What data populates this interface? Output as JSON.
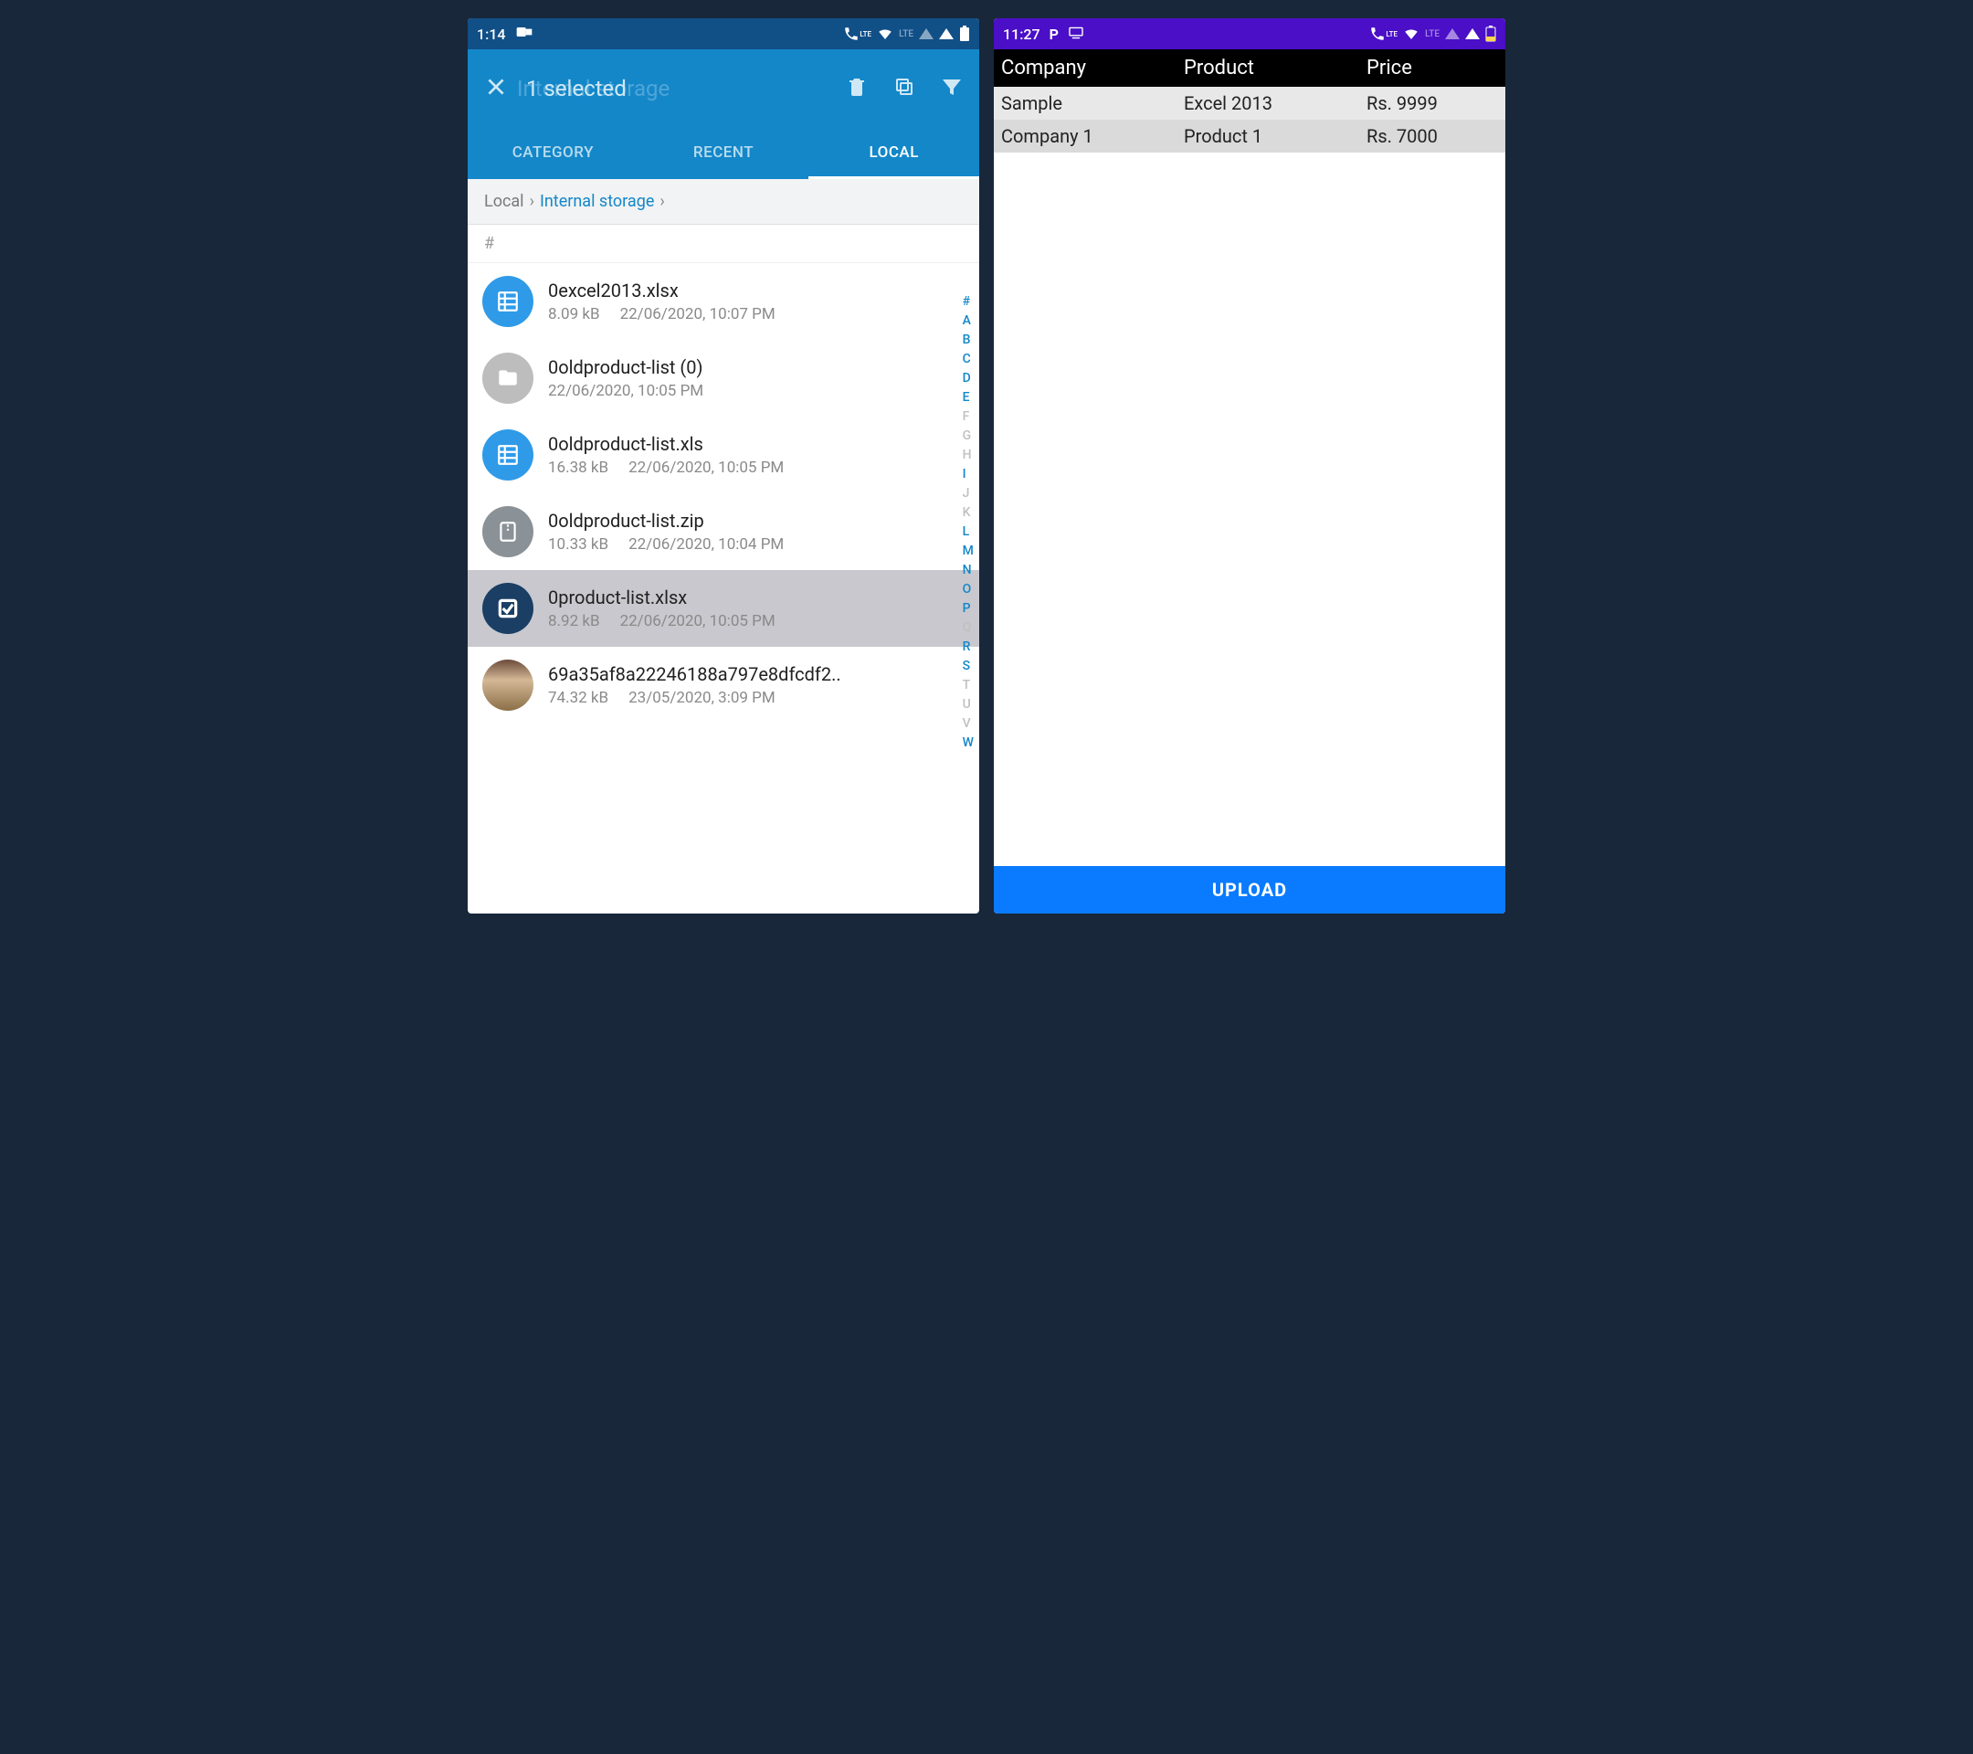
{
  "left": {
    "status": {
      "time": "1:14"
    },
    "appbar": {
      "title": "1 selected",
      "ghost": "Internal storage"
    },
    "tabs": [
      {
        "label": "CATEGORY",
        "active": false
      },
      {
        "label": "RECENT",
        "active": false
      },
      {
        "label": "LOCAL",
        "active": true
      }
    ],
    "breadcrumb": {
      "root": "Local",
      "current": "Internal storage"
    },
    "section": "#",
    "files": [
      {
        "name": "0excel2013.xlsx",
        "size": "8.09 kB",
        "date": "22/06/2020, 10:07 PM",
        "type": "xls",
        "selected": false
      },
      {
        "name": "0oldproduct-list (0)",
        "size": "",
        "date": "22/06/2020, 10:05 PM",
        "type": "folder",
        "selected": false
      },
      {
        "name": "0oldproduct-list.xls",
        "size": "16.38 kB",
        "date": "22/06/2020, 10:05 PM",
        "type": "xls",
        "selected": false
      },
      {
        "name": "0oldproduct-list.zip",
        "size": "10.33 kB",
        "date": "22/06/2020, 10:04 PM",
        "type": "zip",
        "selected": false
      },
      {
        "name": "0product-list.xlsx",
        "size": "8.92 kB",
        "date": "22/06/2020, 10:05 PM",
        "type": "xls",
        "selected": true
      },
      {
        "name": "69a35af8a22246188a797e8dfcdf2..",
        "size": "74.32 kB",
        "date": "23/05/2020, 3:09 PM",
        "type": "img",
        "selected": false
      }
    ],
    "index": {
      "letters": [
        "#",
        "A",
        "B",
        "C",
        "D",
        "E",
        "F",
        "G",
        "H",
        "I",
        "J",
        "K",
        "L",
        "M",
        "N",
        "O",
        "P",
        "Q",
        "R",
        "S",
        "T",
        "U",
        "V",
        "W"
      ],
      "active": [
        "#",
        "A",
        "B",
        "C",
        "D",
        "E",
        "I",
        "L",
        "M",
        "N",
        "O",
        "P",
        "R",
        "S",
        "W"
      ]
    }
  },
  "right": {
    "status": {
      "time": "11:27"
    },
    "headers": [
      "Company",
      "Product",
      "Price"
    ],
    "rows": [
      {
        "company": "Sample",
        "product": "Excel 2013",
        "price": "Rs. 9999"
      },
      {
        "company": "Company 1",
        "product": "Product 1",
        "price": "Rs. 7000"
      }
    ],
    "button": "UPLOAD"
  }
}
